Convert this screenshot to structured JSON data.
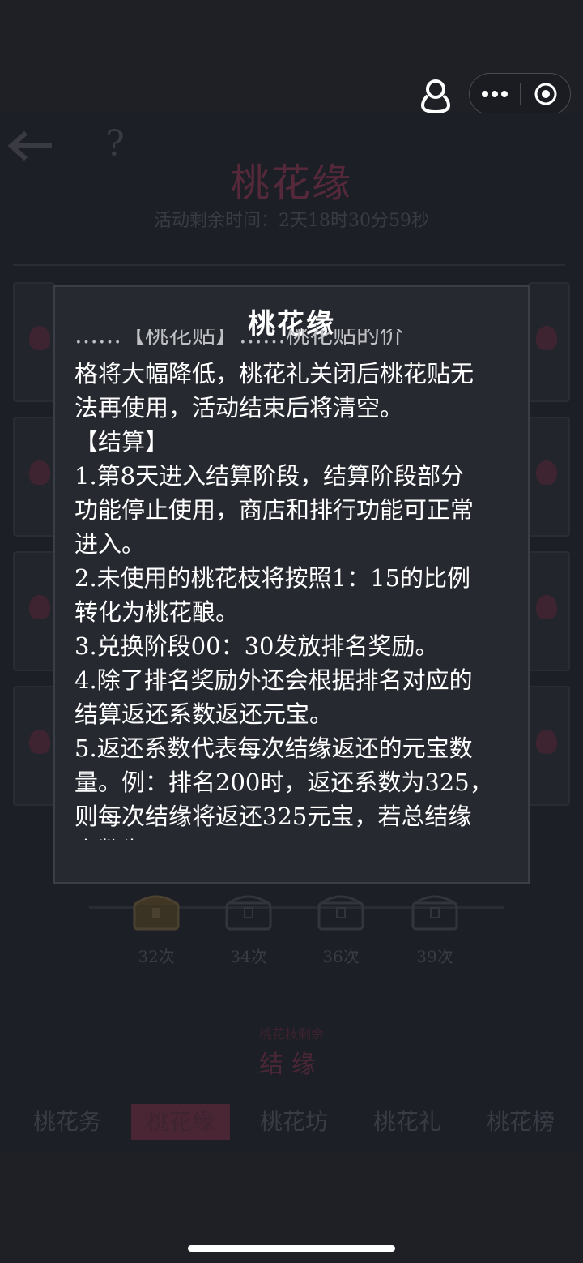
{
  "header": {
    "user_icon": "user-pin-icon",
    "more_icon": "more-dots-icon",
    "close_icon": "target-circle-icon"
  },
  "game": {
    "title": "桃花缘",
    "timer": "活动剩余时间：2天18时30分59秒",
    "help": "?",
    "chests": [
      "32次",
      "34次",
      "36次",
      "39次"
    ],
    "jieyuan_small": "桃花枝剩余",
    "jieyuan_button": "结缘",
    "tabs": [
      "桃花务",
      "桃花缘",
      "桃花坊",
      "桃花礼",
      "桃花榜"
    ],
    "active_tab_index": 1
  },
  "modal": {
    "title": "桃花缘",
    "lines": [
      "……【桃花贴】……桃花贴的价",
      "格将大幅降低，桃花礼关闭后桃花贴无",
      "法再使用，活动结束后将清空。",
      "【结算】",
      "1.第8天进入结算阶段，结算阶段部分",
      "功能停止使用，商店和排行功能可正常",
      "进入。",
      "2.未使用的桃花枝将按照1：15的比例",
      "转化为桃花酿。",
      "3.兑换阶段00：30发放排名奖励。",
      "4.除了排名奖励外还会根据排名对应的",
      "结算返还系数返还元宝。",
      "5.返还系数代表每次结缘返还的元宝数",
      "量。例：排名200时，返还系数为325，",
      "则每次结缘将返还325元宝，若总结缘",
      "次数为……"
    ]
  },
  "colors": {
    "modal_bg": "#262930",
    "page_bg": "#1f2026",
    "accent_dim": "#55293a"
  }
}
